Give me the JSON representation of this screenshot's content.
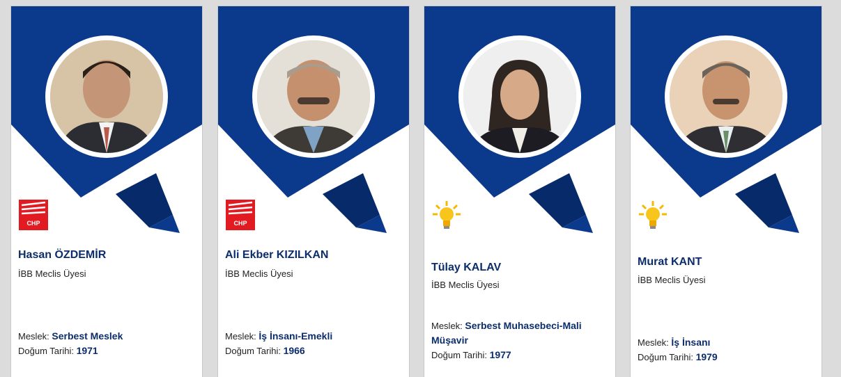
{
  "colors": {
    "banner": "#0b3a8c",
    "banner_dark": "#072a6a",
    "accent_red": "#e21b23",
    "text_blue": "#0c2d6b"
  },
  "labels": {
    "profession": "Meslek: ",
    "birth": "Doğum Tarihi: "
  },
  "members": [
    {
      "name": "Hasan ÖZDEMİR",
      "title": "İBB Meclis Üyesi",
      "profession": "Serbest Meslek",
      "birth_year": "1971",
      "party_icon": "chp-logo-icon"
    },
    {
      "name": "Ali Ekber KIZILKAN",
      "title": "İBB Meclis Üyesi",
      "profession": "İş İnsanı-Emekli",
      "birth_year": "1966",
      "party_icon": "chp-logo-icon"
    },
    {
      "name": "Tülay KALAV",
      "title": "İBB Meclis Üyesi",
      "profession": "Serbest Muhasebeci-Mali Müşavir",
      "birth_year": "1977",
      "party_icon": "ak-parti-bulb-icon"
    },
    {
      "name": "Murat KANT",
      "title": "İBB Meclis Üyesi",
      "profession": "İş İnsanı",
      "birth_year": "1979",
      "party_icon": "ak-parti-bulb-icon"
    }
  ]
}
